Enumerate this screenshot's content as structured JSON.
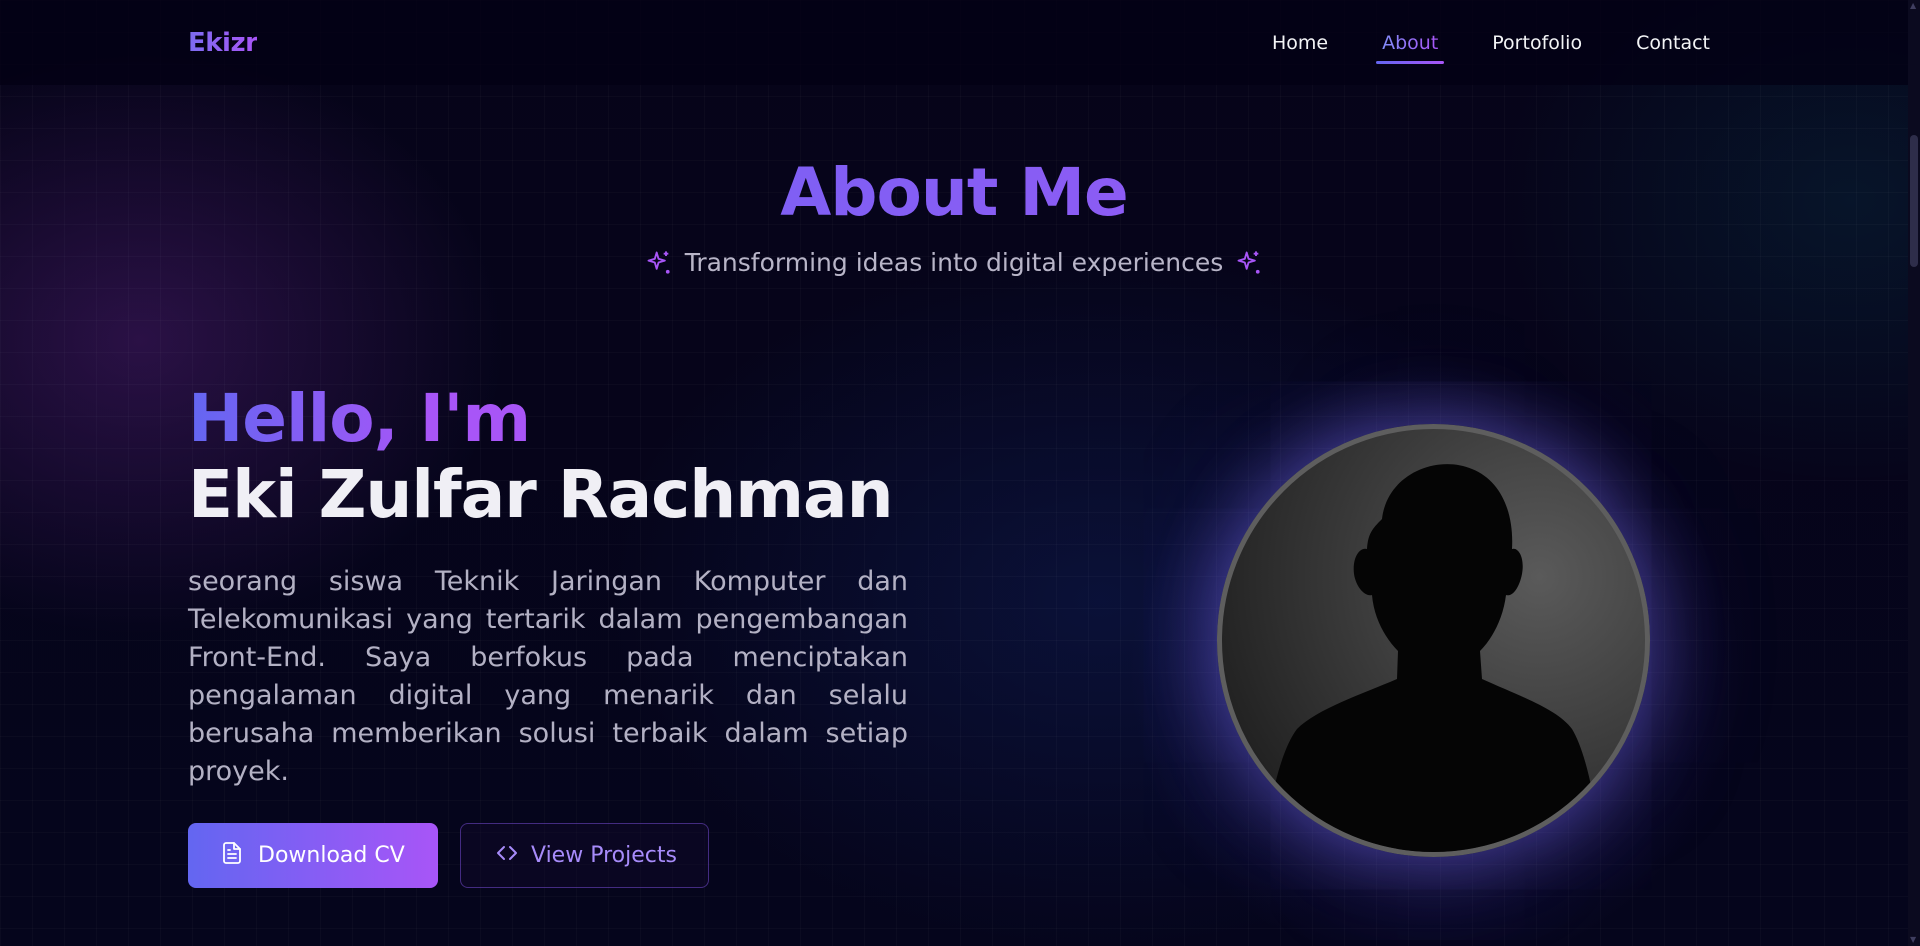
{
  "nav": {
    "logo": "Ekizr",
    "links": [
      "Home",
      "About",
      "Portofolio",
      "Contact"
    ],
    "active": "About"
  },
  "section": {
    "title": "About Me",
    "subtitle": "Transforming ideas into digital experiences"
  },
  "intro": {
    "greeting": "Hello, I'm",
    "name": "Eki Zulfar Rachman",
    "bio": "seorang siswa Teknik Jaringan Komputer dan Telekomunikasi yang tertarik dalam pengembangan Front-End. Saya berfokus pada menciptakan pengalaman digital yang menarik dan selalu berusaha memberikan solusi terbaik dalam setiap proyek."
  },
  "buttons": {
    "download_cv": "Download CV",
    "view_projects": "View Projects"
  },
  "icons": {
    "sparkle": "sparkle-icon",
    "file": "file-icon",
    "code": "code-icon"
  },
  "colors": {
    "accent_start": "#6366f1",
    "accent_end": "#a855f7",
    "background": "#030014"
  }
}
